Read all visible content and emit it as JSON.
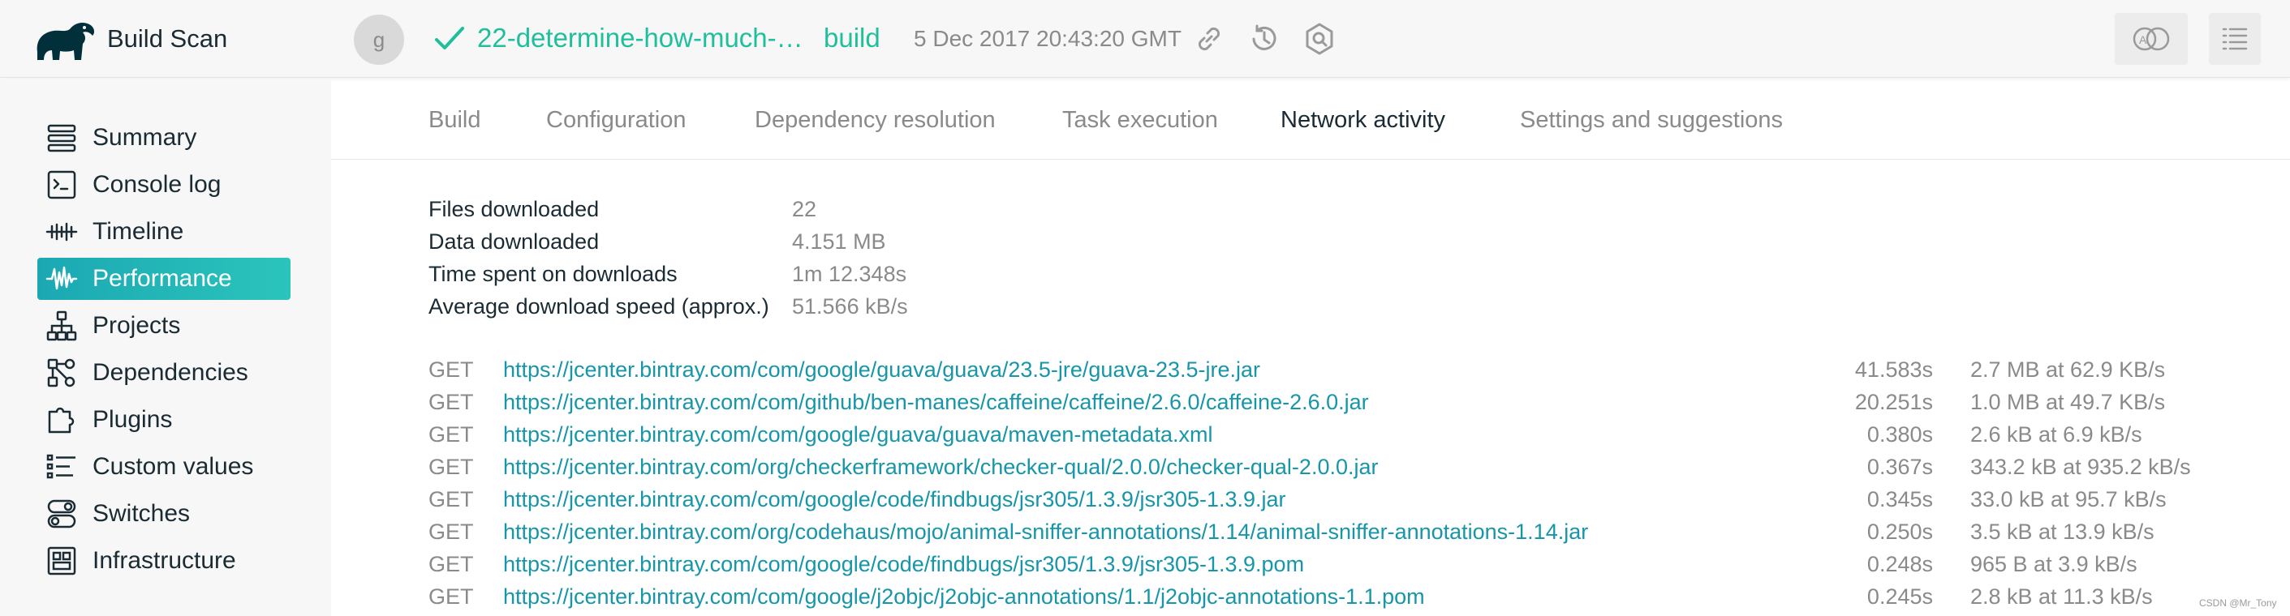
{
  "app": {
    "title": "Build Scan"
  },
  "header": {
    "avatar_letter": "g",
    "branch": "22-determine-how-much-…",
    "outcome": "build",
    "timestamp": "5 Dec 2017 20:43:20 GMT",
    "accent_color": "#1fbf9c",
    "icons": [
      "link-icon",
      "history-icon",
      "scan-icon",
      "compare-icon",
      "outline-icon"
    ]
  },
  "sidebar": {
    "items": [
      {
        "label": "Summary",
        "icon": "summary-icon"
      },
      {
        "label": "Console log",
        "icon": "console-icon"
      },
      {
        "label": "Timeline",
        "icon": "timeline-icon"
      },
      {
        "label": "Performance",
        "icon": "performance-icon",
        "active": true
      },
      {
        "label": "Projects",
        "icon": "projects-icon"
      },
      {
        "label": "Dependencies",
        "icon": "dependencies-icon"
      },
      {
        "label": "Plugins",
        "icon": "plugins-icon"
      },
      {
        "label": "Custom values",
        "icon": "custom-values-icon"
      },
      {
        "label": "Switches",
        "icon": "switches-icon"
      },
      {
        "label": "Infrastructure",
        "icon": "infrastructure-icon"
      }
    ],
    "active_color": "#22b5b7"
  },
  "tabs": [
    {
      "label": "Build"
    },
    {
      "label": "Configuration"
    },
    {
      "label": "Dependency resolution"
    },
    {
      "label": "Task execution"
    },
    {
      "label": "Network activity",
      "active": true
    },
    {
      "label": "Settings and suggestions"
    }
  ],
  "stats": [
    {
      "label": "Files downloaded",
      "value": "22"
    },
    {
      "label": "Data downloaded",
      "value": "4.151 MB"
    },
    {
      "label": "Time spent on downloads",
      "value": "1m 12.348s"
    },
    {
      "label": "Average download speed (approx.)",
      "value": "51.566 kB/s"
    }
  ],
  "downloads": [
    {
      "method": "GET",
      "url": "https://jcenter.bintray.com/com/google/guava/guava/23.5-jre/guava-23.5-jre.jar",
      "time": "41.583s",
      "size": "2.7 MB at 62.9 KB/s"
    },
    {
      "method": "GET",
      "url": "https://jcenter.bintray.com/com/github/ben-manes/caffeine/caffeine/2.6.0/caffeine-2.6.0.jar",
      "time": "20.251s",
      "size": "1.0 MB at 49.7 KB/s"
    },
    {
      "method": "GET",
      "url": "https://jcenter.bintray.com/com/google/guava/guava/maven-metadata.xml",
      "time": "0.380s",
      "size": "2.6 kB at 6.9 kB/s"
    },
    {
      "method": "GET",
      "url": "https://jcenter.bintray.com/org/checkerframework/checker-qual/2.0.0/checker-qual-2.0.0.jar",
      "time": "0.367s",
      "size": "343.2 kB at 935.2 kB/s"
    },
    {
      "method": "GET",
      "url": "https://jcenter.bintray.com/com/google/code/findbugs/jsr305/1.3.9/jsr305-1.3.9.jar",
      "time": "0.345s",
      "size": "33.0 kB at 95.7 kB/s"
    },
    {
      "method": "GET",
      "url": "https://jcenter.bintray.com/org/codehaus/mojo/animal-sniffer-annotations/1.14/animal-sniffer-annotations-1.14.jar",
      "time": "0.250s",
      "size": "3.5 kB at 13.9 kB/s"
    },
    {
      "method": "GET",
      "url": "https://jcenter.bintray.com/com/google/code/findbugs/jsr305/1.3.9/jsr305-1.3.9.pom",
      "time": "0.248s",
      "size": "965 B at 3.9 kB/s"
    },
    {
      "method": "GET",
      "url": "https://jcenter.bintray.com/com/google/j2objc/j2objc-annotations/1.1/j2objc-annotations-1.1.pom",
      "time": "0.245s",
      "size": "2.8 kB at 11.3 kB/s"
    }
  ],
  "watermark": "CSDN @Mr_Tony"
}
